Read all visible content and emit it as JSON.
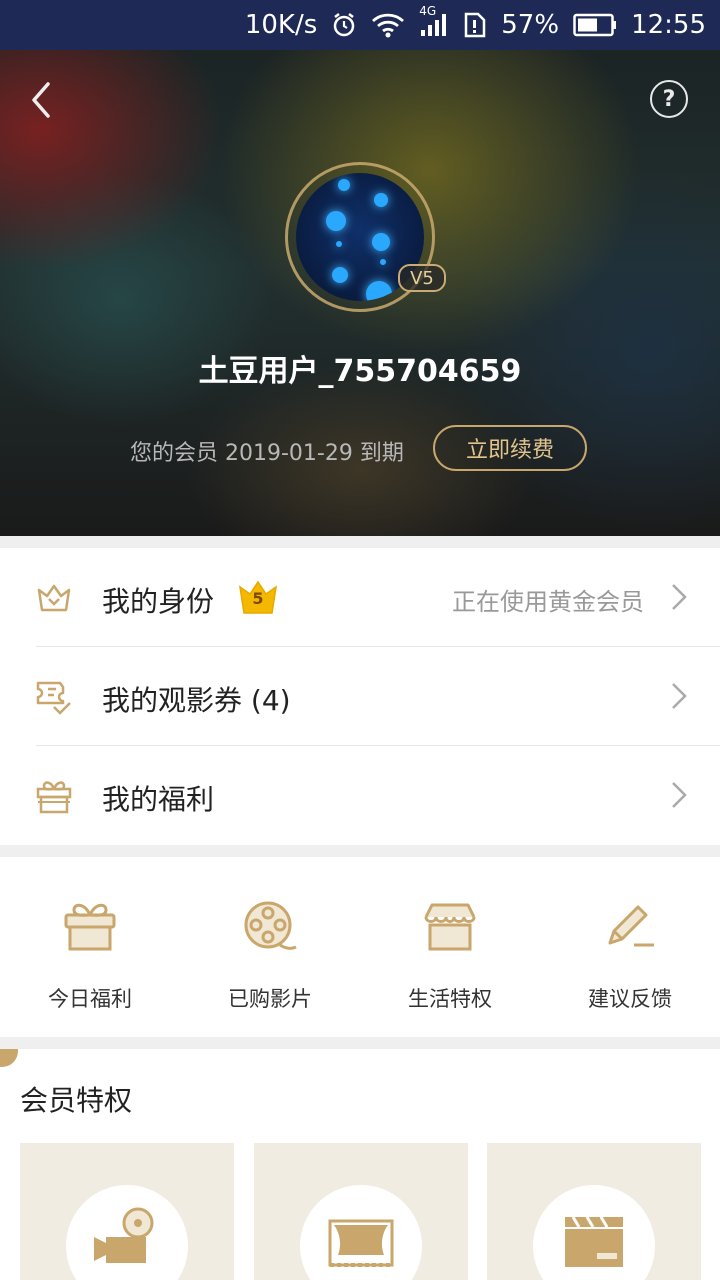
{
  "status_bar": {
    "net_speed": "10K/s",
    "signal_type": "4G",
    "battery": "57%",
    "time": "12:55"
  },
  "header": {
    "back_icon": "chevron-left-icon",
    "help_icon": "question-mark-icon",
    "help_glyph": "?"
  },
  "profile": {
    "level_badge": "V5",
    "username": "土豆用户_755704659",
    "expire_text": "您的会员 2019-01-29 到期",
    "renew_label": "立即续费"
  },
  "menu": {
    "items": [
      {
        "label": "我的身份",
        "icon": "crown-icon",
        "badge": "5",
        "right_text": "正在使用黄金会员"
      },
      {
        "label": "我的观影券 (4)",
        "icon": "ticket-icon"
      },
      {
        "label": "我的福利",
        "icon": "gift-icon"
      }
    ]
  },
  "quick_actions": [
    {
      "label": "今日福利",
      "icon": "gift-box-icon"
    },
    {
      "label": "已购影片",
      "icon": "film-reel-icon"
    },
    {
      "label": "生活特权",
      "icon": "shop-icon"
    },
    {
      "label": "建议反馈",
      "icon": "edit-pen-icon"
    }
  ],
  "privileges": {
    "title": "会员特权",
    "cards": [
      {
        "icon": "movie-camera-icon"
      },
      {
        "icon": "theater-stage-icon"
      },
      {
        "icon": "clapperboard-icon"
      }
    ]
  },
  "colors": {
    "accent_gold": "#c9a66b",
    "status_bar_bg": "#1e2a55",
    "card_bg": "#f0ece1"
  }
}
